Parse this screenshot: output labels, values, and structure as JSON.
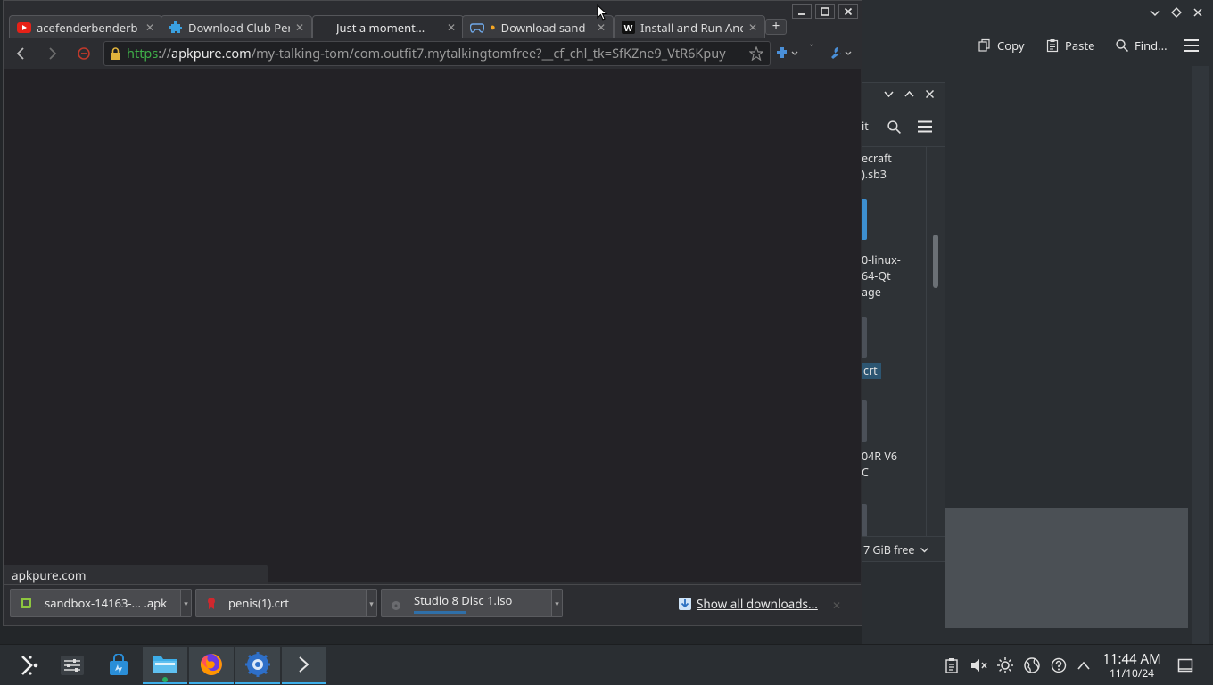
{
  "background_window": {
    "toolbar": {
      "copy_label": "Copy",
      "paste_label": "Paste",
      "find_label": "Find..."
    }
  },
  "dialog": {
    "files": [
      {
        "line1": "ecraft",
        "line2": ").sb3"
      },
      {
        "line1": "0-linux-",
        "line2": "64-Qt",
        "line3": "age"
      },
      {
        "line1": "crt"
      },
      {
        "line1": "04R V6",
        "line2": "C"
      }
    ],
    "partial_label": "it",
    "free_space": "7 GiB free"
  },
  "browser": {
    "tabs": [
      {
        "label": "acefenderbenderb",
        "icon": "youtube-icon",
        "active": false
      },
      {
        "label": "Download Club Per",
        "icon": "puzzle-icon",
        "active": false
      },
      {
        "label": "Just a moment...",
        "icon": "",
        "active": true
      },
      {
        "label": "Download sand",
        "icon": "gamepad-icon",
        "active": false
      },
      {
        "label": "Install and Run And",
        "icon": "w-icon",
        "active": false
      }
    ],
    "url": {
      "scheme": "https",
      "host": "apkpure.com",
      "path": "/my-talking-tom/com.outfit7.mytalkingtomfree?__cf_chl_tk=SfKZne9_VtR6Kpuy"
    },
    "status_text": "apkpure.com",
    "downloads": [
      {
        "name": "sandbox-14163-... .apk",
        "icon": "android-icon"
      },
      {
        "name": "penis(1).crt",
        "icon": "certificate-icon"
      },
      {
        "name": "Studio 8 Disc 1.iso",
        "icon": "disc-icon"
      }
    ],
    "show_all_downloads": "Show all downloads..."
  },
  "taskbar": {
    "time": "11:44 AM",
    "date": "11/10/24"
  },
  "colors": {
    "accent": "#3daee9",
    "url_scheme_green": "#3fae49",
    "bg_dark": "#232226"
  }
}
